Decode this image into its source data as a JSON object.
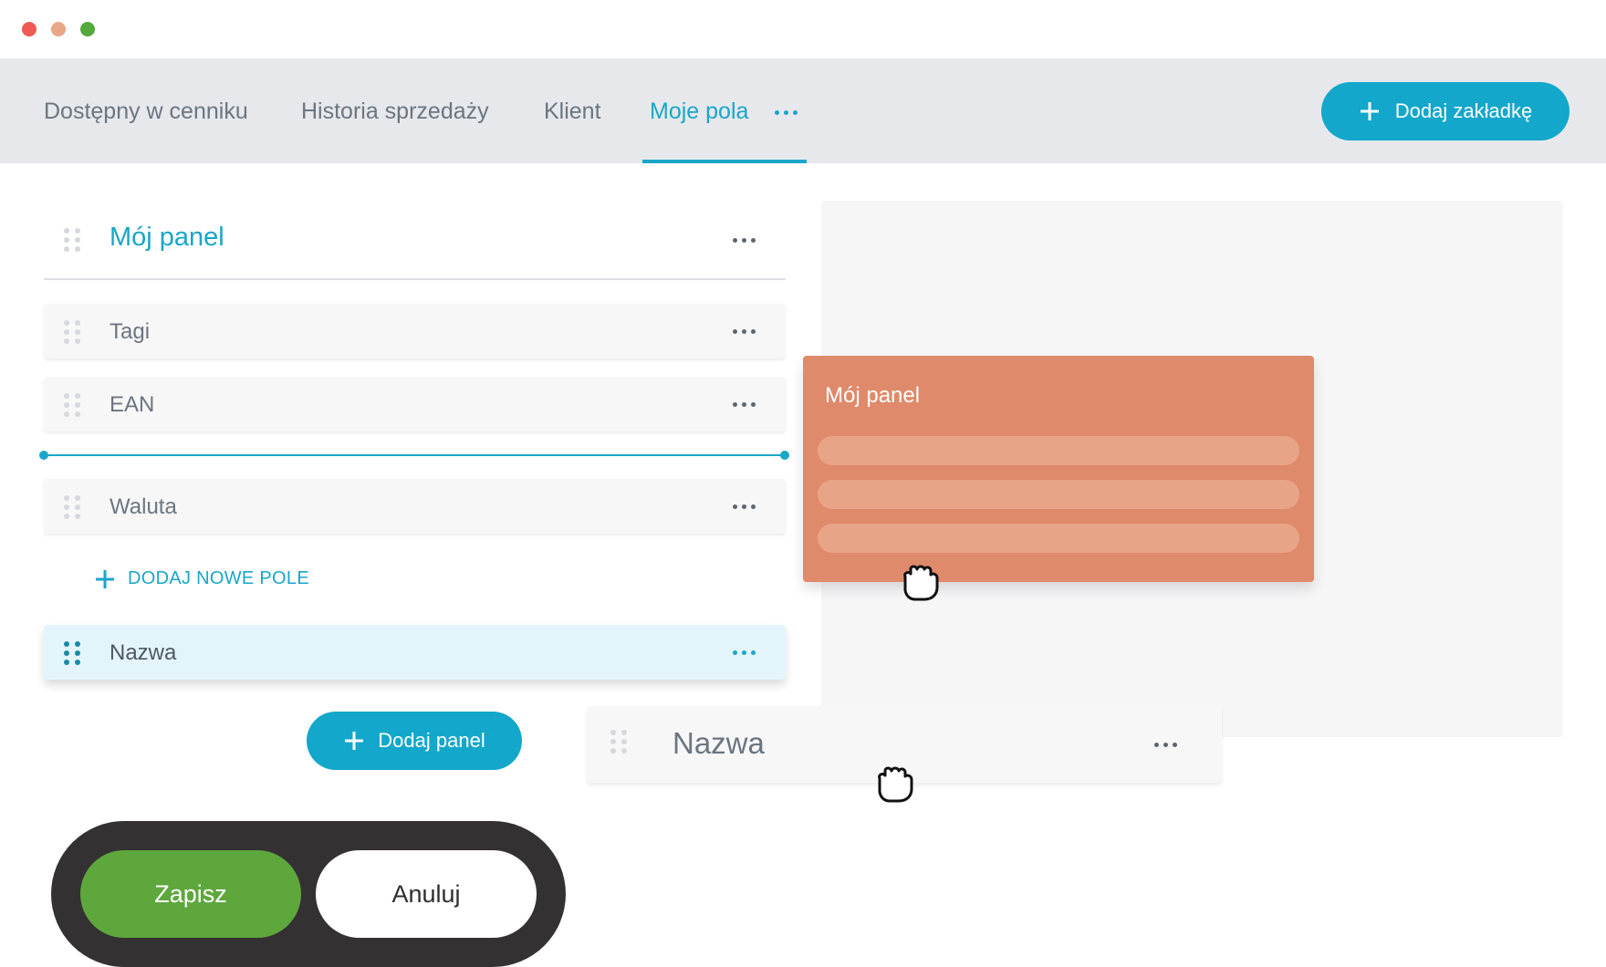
{
  "window": {
    "controls": [
      {
        "name": "close",
        "color": "#ef5b52"
      },
      {
        "name": "minimize",
        "color": "#e9a788"
      },
      {
        "name": "maximize",
        "color": "#55a83c"
      }
    ]
  },
  "tabs": [
    {
      "label": "Dostępny w cenniku",
      "active": false
    },
    {
      "label": "Historia sprzedaży",
      "active": false
    },
    {
      "label": "Klient",
      "active": false
    },
    {
      "label": "Moje pola",
      "active": true
    }
  ],
  "add_tab_label": "Dodaj zakładkę",
  "panel": {
    "title": "Mój panel",
    "fields": [
      "Tagi",
      "EAN",
      "Waluta"
    ],
    "add_field_label": "DODAJ NOWE POLE",
    "selected_field": "Nazwa"
  },
  "add_panel_label": "Dodaj panel",
  "dragged_panel": {
    "title": "Mój panel"
  },
  "dragged_field": {
    "label": "Nazwa"
  },
  "actions": {
    "save_label": "Zapisz",
    "cancel_label": "Anuluj"
  },
  "colors": {
    "accent": "#1aa6c8",
    "tab_bar": "#e6e8ec",
    "ghost_panel": "#df8a6a",
    "save": "#5ea73d",
    "action_bar": "#343132"
  }
}
